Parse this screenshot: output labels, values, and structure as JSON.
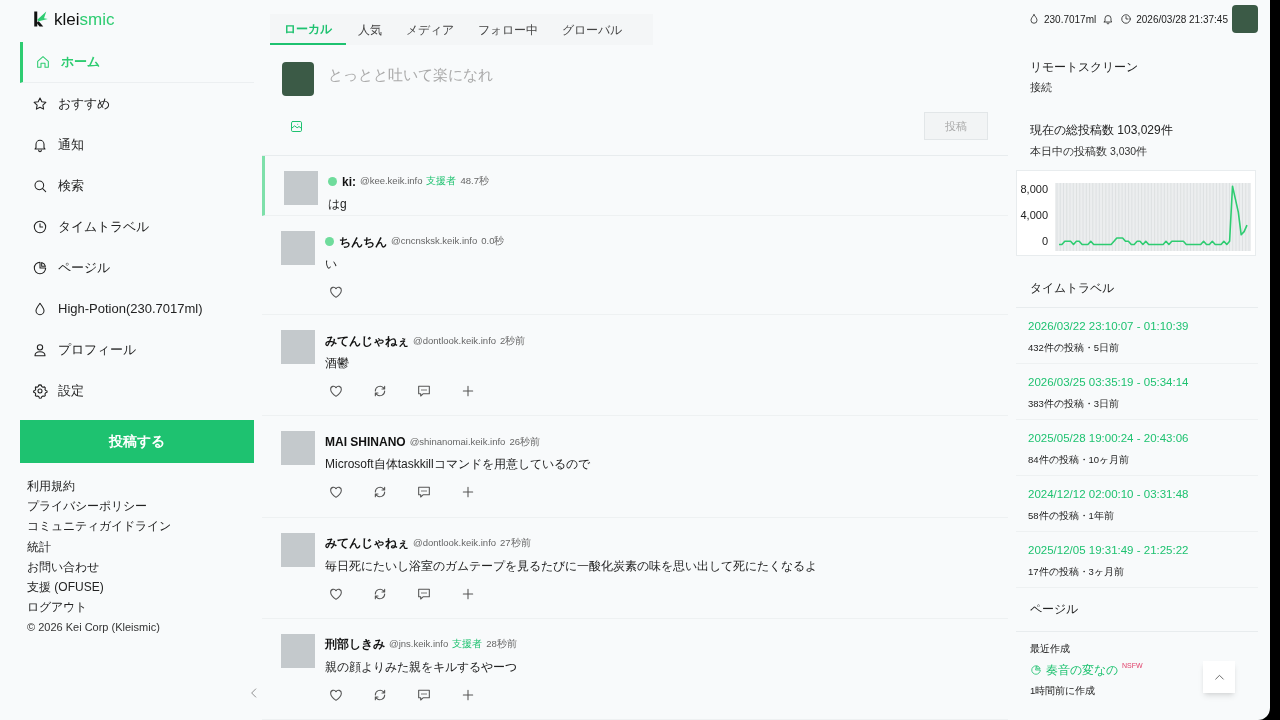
{
  "logo": {
    "prefix": "klei",
    "suffix": "smic"
  },
  "nav": [
    {
      "label": "ホーム",
      "selected": true
    },
    {
      "label": "おすすめ",
      "selected": false
    },
    {
      "label": "通知",
      "selected": false
    },
    {
      "label": "検索",
      "selected": false
    },
    {
      "label": "タイムトラベル",
      "selected": false
    },
    {
      "label": "ページル",
      "selected": false
    },
    {
      "label": "High-Potion(230.7017ml)",
      "selected": false
    },
    {
      "label": "プロフィール",
      "selected": false
    },
    {
      "label": "設定",
      "selected": false
    }
  ],
  "post_button": "投稿する",
  "footer_links": [
    "利用規約",
    "プライバシーポリシー",
    "コミュニティガイドライン",
    "統計",
    "お問い合わせ",
    "支援 (OFUSE)",
    "ログアウト"
  ],
  "copyright": "© 2026 Kei Corp (Kleismic)",
  "tabs": [
    {
      "label": "ローカル",
      "selected": true
    },
    {
      "label": "人気",
      "selected": false
    },
    {
      "label": "メディア",
      "selected": false
    },
    {
      "label": "フォロー中",
      "selected": false
    },
    {
      "label": "グローバル",
      "selected": false
    }
  ],
  "composer": {
    "placeholder": "とっとと吐いて楽になれ",
    "submit": {
      "label": "投稿",
      "disabled": true
    }
  },
  "posts": [
    {
      "kind": "plain",
      "author": "ki:",
      "handle": "@kee.keik.info",
      "badge": "支援者",
      "time": "48.7秒",
      "body": "はg",
      "online": true,
      "highlighted": true
    },
    {
      "kind": "like_only",
      "author": "ちんちん",
      "handle": "@cncnsksk.keik.info",
      "time": "0.0秒",
      "body": "い",
      "online": true,
      "highlighted": false
    },
    {
      "kind": "full",
      "author": "みてんじゃねぇ",
      "handle": "@dontlook.keik.info",
      "time": "2秒前",
      "body": "酒鬱",
      "online": false,
      "highlighted": false
    },
    {
      "kind": "full",
      "author": "MAI SHINANO",
      "handle": "@shinanomai.keik.info",
      "time": "26秒前",
      "body": "Microsoft自体taskkillコマンドを用意しているので",
      "online": false,
      "highlighted": false
    },
    {
      "kind": "full",
      "author": "みてんじゃねぇ",
      "handle": "@dontlook.keik.info",
      "time": "27秒前",
      "body": "毎日死にたいし浴室のガムテープを見るたびに一酸化炭素の味を思い出して死にたくなるよ",
      "online": false,
      "highlighted": false
    },
    {
      "kind": "full",
      "author": "刑部しきみ",
      "handle": "@jns.keik.info",
      "badge": "支援者",
      "time": "28秒前",
      "body": "親の顔よりみた親をキルするやーつ",
      "online": false,
      "highlighted": false
    }
  ],
  "header": {
    "potion": "230.7017ml",
    "datetime": "2026/03/28 21:37:45"
  },
  "remote_screen": {
    "title": "リモートスクリーン",
    "status": "接続"
  },
  "stats": {
    "title": "現在の総投稿数 103,029件",
    "subtitle": "本日中の投稿数 3,030件",
    "chart_data": {
      "type": "line",
      "ylim": [
        -1000,
        9500
      ],
      "yticks": [
        {
          "value": 0,
          "label": "0"
        },
        {
          "value": 4000,
          "label": "4,000"
        },
        {
          "value": 8000,
          "label": "8,000"
        }
      ],
      "series": [
        {
          "color": "#2ecc71",
          "values": [
            0,
            0,
            500,
            500,
            500,
            0,
            500,
            500,
            0,
            0,
            0,
            500,
            0,
            0,
            0,
            0,
            0,
            0,
            0,
            500,
            1000,
            1000,
            1000,
            500,
            500,
            0,
            0,
            500,
            500,
            0,
            500,
            0,
            0,
            0,
            0,
            0,
            0,
            500,
            0,
            500,
            500,
            500,
            500,
            500,
            0,
            0,
            0,
            0,
            0,
            0,
            500,
            0,
            0,
            500,
            0,
            0,
            0,
            500,
            0,
            500,
            9000,
            7000,
            5000,
            1500,
            2000,
            3000
          ]
        }
      ]
    }
  },
  "time_travel": {
    "title": "タイムトラベル",
    "items": [
      {
        "range": "2026/03/22 23:10:07 - 01:10:39",
        "meta": "432件の投稿・5日前"
      },
      {
        "range": "2026/03/25 03:35:19 - 05:34:14",
        "meta": "383件の投稿・3日前"
      },
      {
        "range": "2025/05/28 19:00:24 - 20:43:06",
        "meta": "84件の投稿・10ヶ月前"
      },
      {
        "range": "2024/12/12 02:00:10 - 03:31:48",
        "meta": "58件の投稿・1年前"
      },
      {
        "range": "2025/12/05 19:31:49 - 21:25:22",
        "meta": "17件の投稿・3ヶ月前"
      }
    ]
  },
  "pagel": {
    "title": "ページル",
    "label": "最近作成",
    "item": {
      "name": "奏音の変なの",
      "tag": "NSFW"
    },
    "meta": "1時間前に作成"
  }
}
